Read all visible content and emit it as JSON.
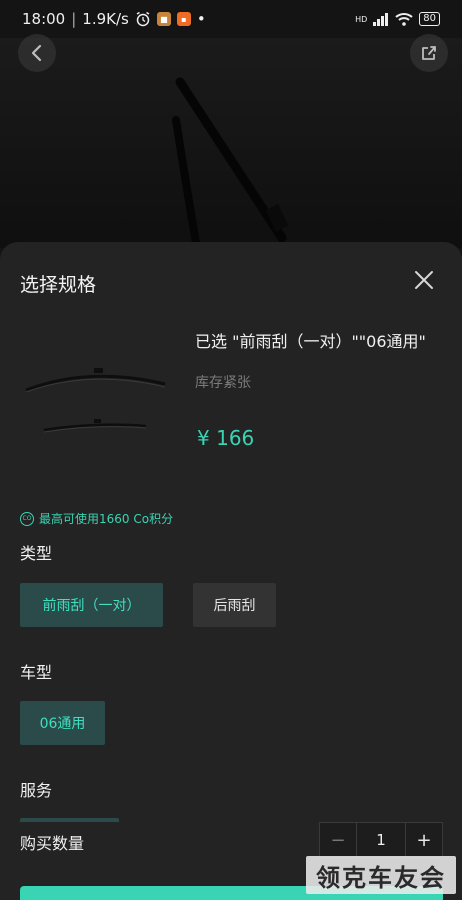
{
  "status_bar": {
    "time": "18:00",
    "speed": "1.9K/s",
    "battery": "80",
    "network": "HD"
  },
  "sheet": {
    "title": "选择规格",
    "selected": "已选 \"前雨刮（一对）\"\"06通用\"",
    "stock": "库存紧张",
    "price_symbol": "¥",
    "price_value": "166",
    "points_text": "最高可使用1660 Co积分",
    "points_icon_text": "CO"
  },
  "sections": {
    "type_label": "类型",
    "type_options": [
      "前雨刮（一对）",
      "后雨刮"
    ],
    "model_label": "车型",
    "model_options": [
      "06通用"
    ],
    "service_label": "服务",
    "quantity_label": "购买数量"
  },
  "quantity": {
    "minus": "−",
    "value": "1",
    "plus": "+"
  },
  "watermark": "领克车友会",
  "colors": {
    "accent": "#38d4b4",
    "option_active_bg": "#2b4a4a",
    "sheet_bg": "#232323"
  },
  "icons": {
    "back": "back-arrow-icon",
    "share": "share-icon",
    "close": "close-icon",
    "points": "co-points-icon"
  }
}
